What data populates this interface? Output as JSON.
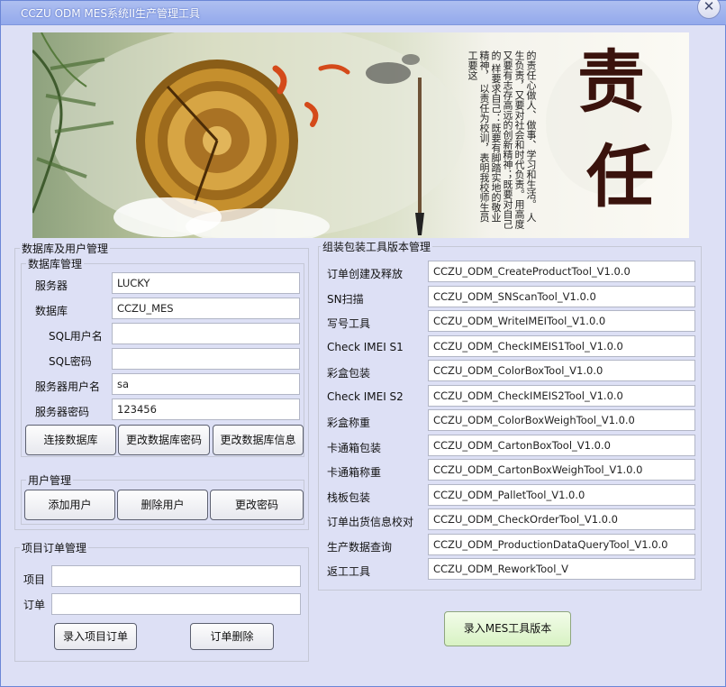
{
  "window": {
    "title": "CCZU ODM MES系统II生产管理工具",
    "close_label": "✕"
  },
  "banner": {
    "big_text": [
      "责",
      "任"
    ],
    "lines": [
      "以责任为校训，表明我校师生员工要这",
      "样要求自己：既要有脚踏实地的敬业精神，",
      "又要有志存高远的创新精神；既要对自己的",
      "人生负责，又要对社会和时代负责。用高度",
      "的责任心做人、做事、学习和生活。"
    ]
  },
  "db_user_group": {
    "title": "数据库及用户管理",
    "db": {
      "title": "数据库管理",
      "fields": [
        {
          "label": "服务器",
          "value": "LUCKY"
        },
        {
          "label": "数据库",
          "value": "CCZU_MES"
        },
        {
          "label": "SQL用户名",
          "value": ""
        },
        {
          "label": "SQL密码",
          "value": ""
        },
        {
          "label": "服务器用户名",
          "value": "sa"
        },
        {
          "label": "服务器密码",
          "value": "123456"
        }
      ],
      "buttons": [
        "连接数据库",
        "更改数据库密码",
        "更改数据库信息"
      ]
    },
    "user": {
      "title": "用户管理",
      "buttons": [
        "添加用户",
        "删除用户",
        "更改密码"
      ]
    }
  },
  "project": {
    "title": "项目订单管理",
    "fields": [
      {
        "label": "项目",
        "value": ""
      },
      {
        "label": "订单",
        "value": ""
      }
    ],
    "buttons": [
      "录入项目订单",
      "订单删除"
    ]
  },
  "tools": {
    "title": "组装包装工具版本管理",
    "rows": [
      {
        "label": "订单创建及释放",
        "value": "CCZU_ODM_CreateProductTool_V1.0.0"
      },
      {
        "label": "SN扫描",
        "value": "CCZU_ODM_SNScanTool_V1.0.0"
      },
      {
        "label": "写号工具",
        "value": "CCZU_ODM_WriteIMEITool_V1.0.0"
      },
      {
        "label": "Check IMEI S1",
        "value": "CCZU_ODM_CheckIMEIS1Tool_V1.0.0"
      },
      {
        "label": "彩盒包装",
        "value": "CCZU_ODM_ColorBoxTool_V1.0.0"
      },
      {
        "label": "Check IMEI S2",
        "value": "CCZU_ODM_CheckIMEIS2Tool_V1.0.0"
      },
      {
        "label": "彩盒称重",
        "value": "CCZU_ODM_ColorBoxWeighTool_V1.0.0"
      },
      {
        "label": "卡通箱包装",
        "value": "CCZU_ODM_CartonBoxTool_V1.0.0"
      },
      {
        "label": "卡通箱称重",
        "value": "CCZU_ODM_CartonBoxWeighTool_V1.0.0"
      },
      {
        "label": "栈板包装",
        "value": "CCZU_ODM_PalletTool_V1.0.0"
      },
      {
        "label": "订单出货信息校对",
        "value": "CCZU_ODM_CheckOrderTool_V1.0.0"
      },
      {
        "label": "生产数据查询",
        "value": "CCZU_ODM_ProductionDataQueryTool_V1.0.0"
      },
      {
        "label": "返工工具",
        "value": "CCZU_ODM_ReworkTool_V"
      }
    ],
    "submit": "录入MES工具版本"
  }
}
